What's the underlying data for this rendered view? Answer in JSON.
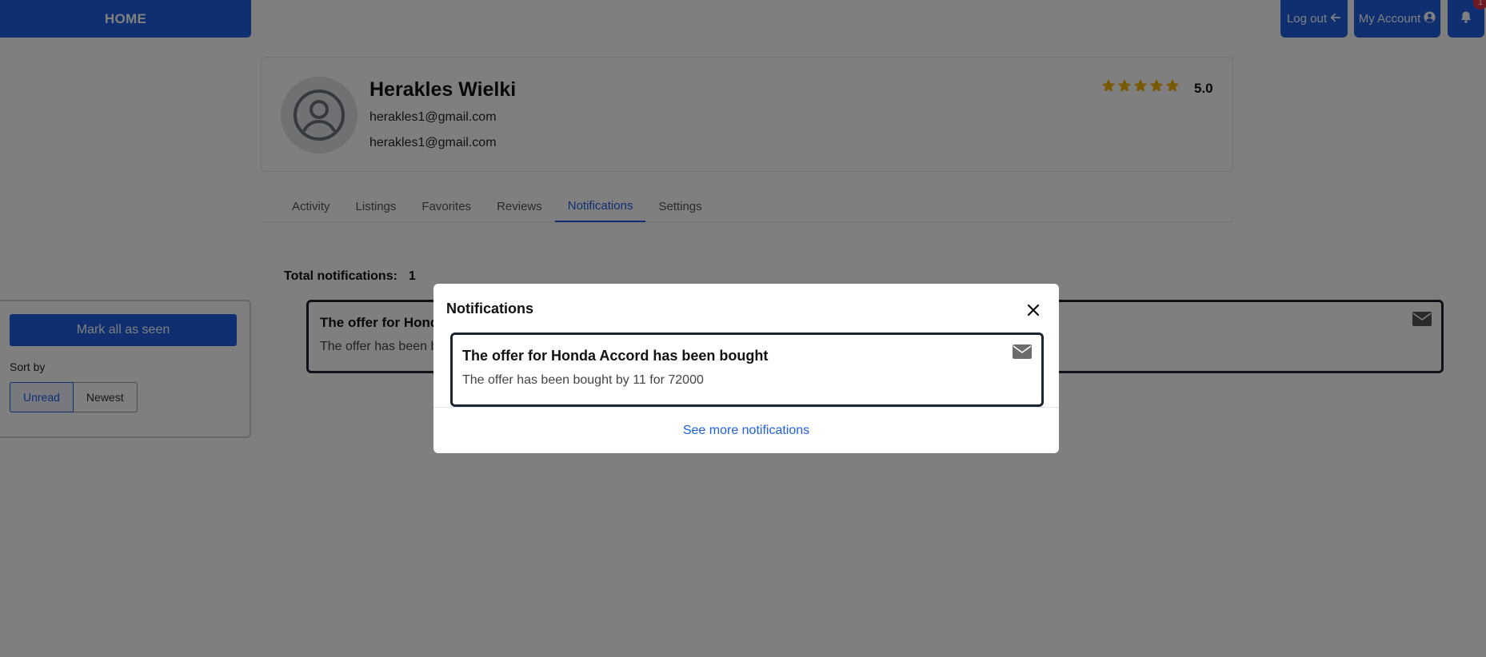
{
  "nav": {
    "home_label": "HOME",
    "logout_label": "Log out",
    "account_label": "My Account",
    "bell_badge": "1"
  },
  "profile": {
    "name": "Herakles Wielki",
    "email_primary": "herakles1@gmail.com",
    "email_secondary": "herakles1@gmail.com",
    "rating": "5.0",
    "stars": 5
  },
  "tabs": [
    {
      "label": "Activity"
    },
    {
      "label": "Listings"
    },
    {
      "label": "Favorites"
    },
    {
      "label": "Reviews"
    },
    {
      "label": "Notifications",
      "active": true
    },
    {
      "label": "Settings"
    }
  ],
  "sidebar": {
    "mark_all_label": "Mark all as seen",
    "sort_label": "Sort by",
    "sort_options": [
      "Unread",
      "Newest"
    ],
    "sort_selected": "Unread"
  },
  "list": {
    "total_label": "Total notifications:",
    "total_count": "1",
    "items": [
      {
        "title": "The offer for Honda Accord has been bought",
        "body": "The offer has been bought by 11 for 72000"
      }
    ]
  },
  "modal": {
    "title": "Notifications",
    "items": [
      {
        "title": "The offer for Honda Accord has been bought",
        "body": "The offer has been bought by 11 for 72000"
      }
    ],
    "see_more_label": "See more notifications"
  },
  "colors": {
    "primary": "#1f5fe0",
    "star": "#f0b000",
    "badge": "#dc3545"
  },
  "icons": [
    "arrow-left-icon",
    "user-circle-icon",
    "bell-icon",
    "star-icon",
    "envelope-icon",
    "close-icon",
    "avatar-icon"
  ]
}
